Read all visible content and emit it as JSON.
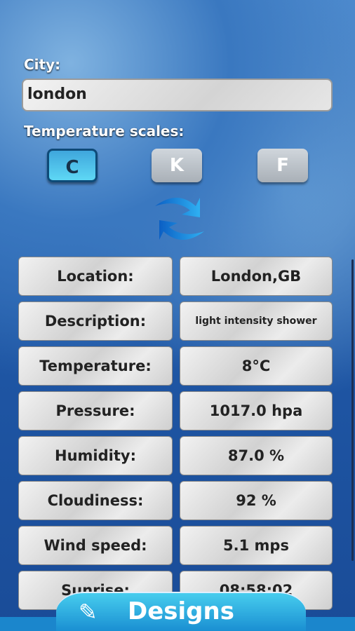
{
  "city": {
    "label": "City:",
    "value": "london"
  },
  "scales": {
    "label": "Temperature scales:",
    "options": [
      "C",
      "K",
      "F"
    ],
    "selected": "C"
  },
  "refresh_icon": "refresh-arrows-icon",
  "rows": [
    {
      "label": "Location:",
      "value": "London,GB"
    },
    {
      "label": "Description:",
      "value": "light intensity shower"
    },
    {
      "label": "Temperature:",
      "value": "8°C"
    },
    {
      "label": "Pressure:",
      "value": "1017.0 hpa"
    },
    {
      "label": "Humidity:",
      "value": "87.0 %"
    },
    {
      "label": "Cloudiness:",
      "value": "92 %"
    },
    {
      "label": "Wind speed:",
      "value": "5.1 mps"
    },
    {
      "label": "Sunrise:",
      "value": "08:58:02"
    }
  ],
  "footer": {
    "brand": "Designs",
    "icon": "pencil-ruler-icon"
  }
}
